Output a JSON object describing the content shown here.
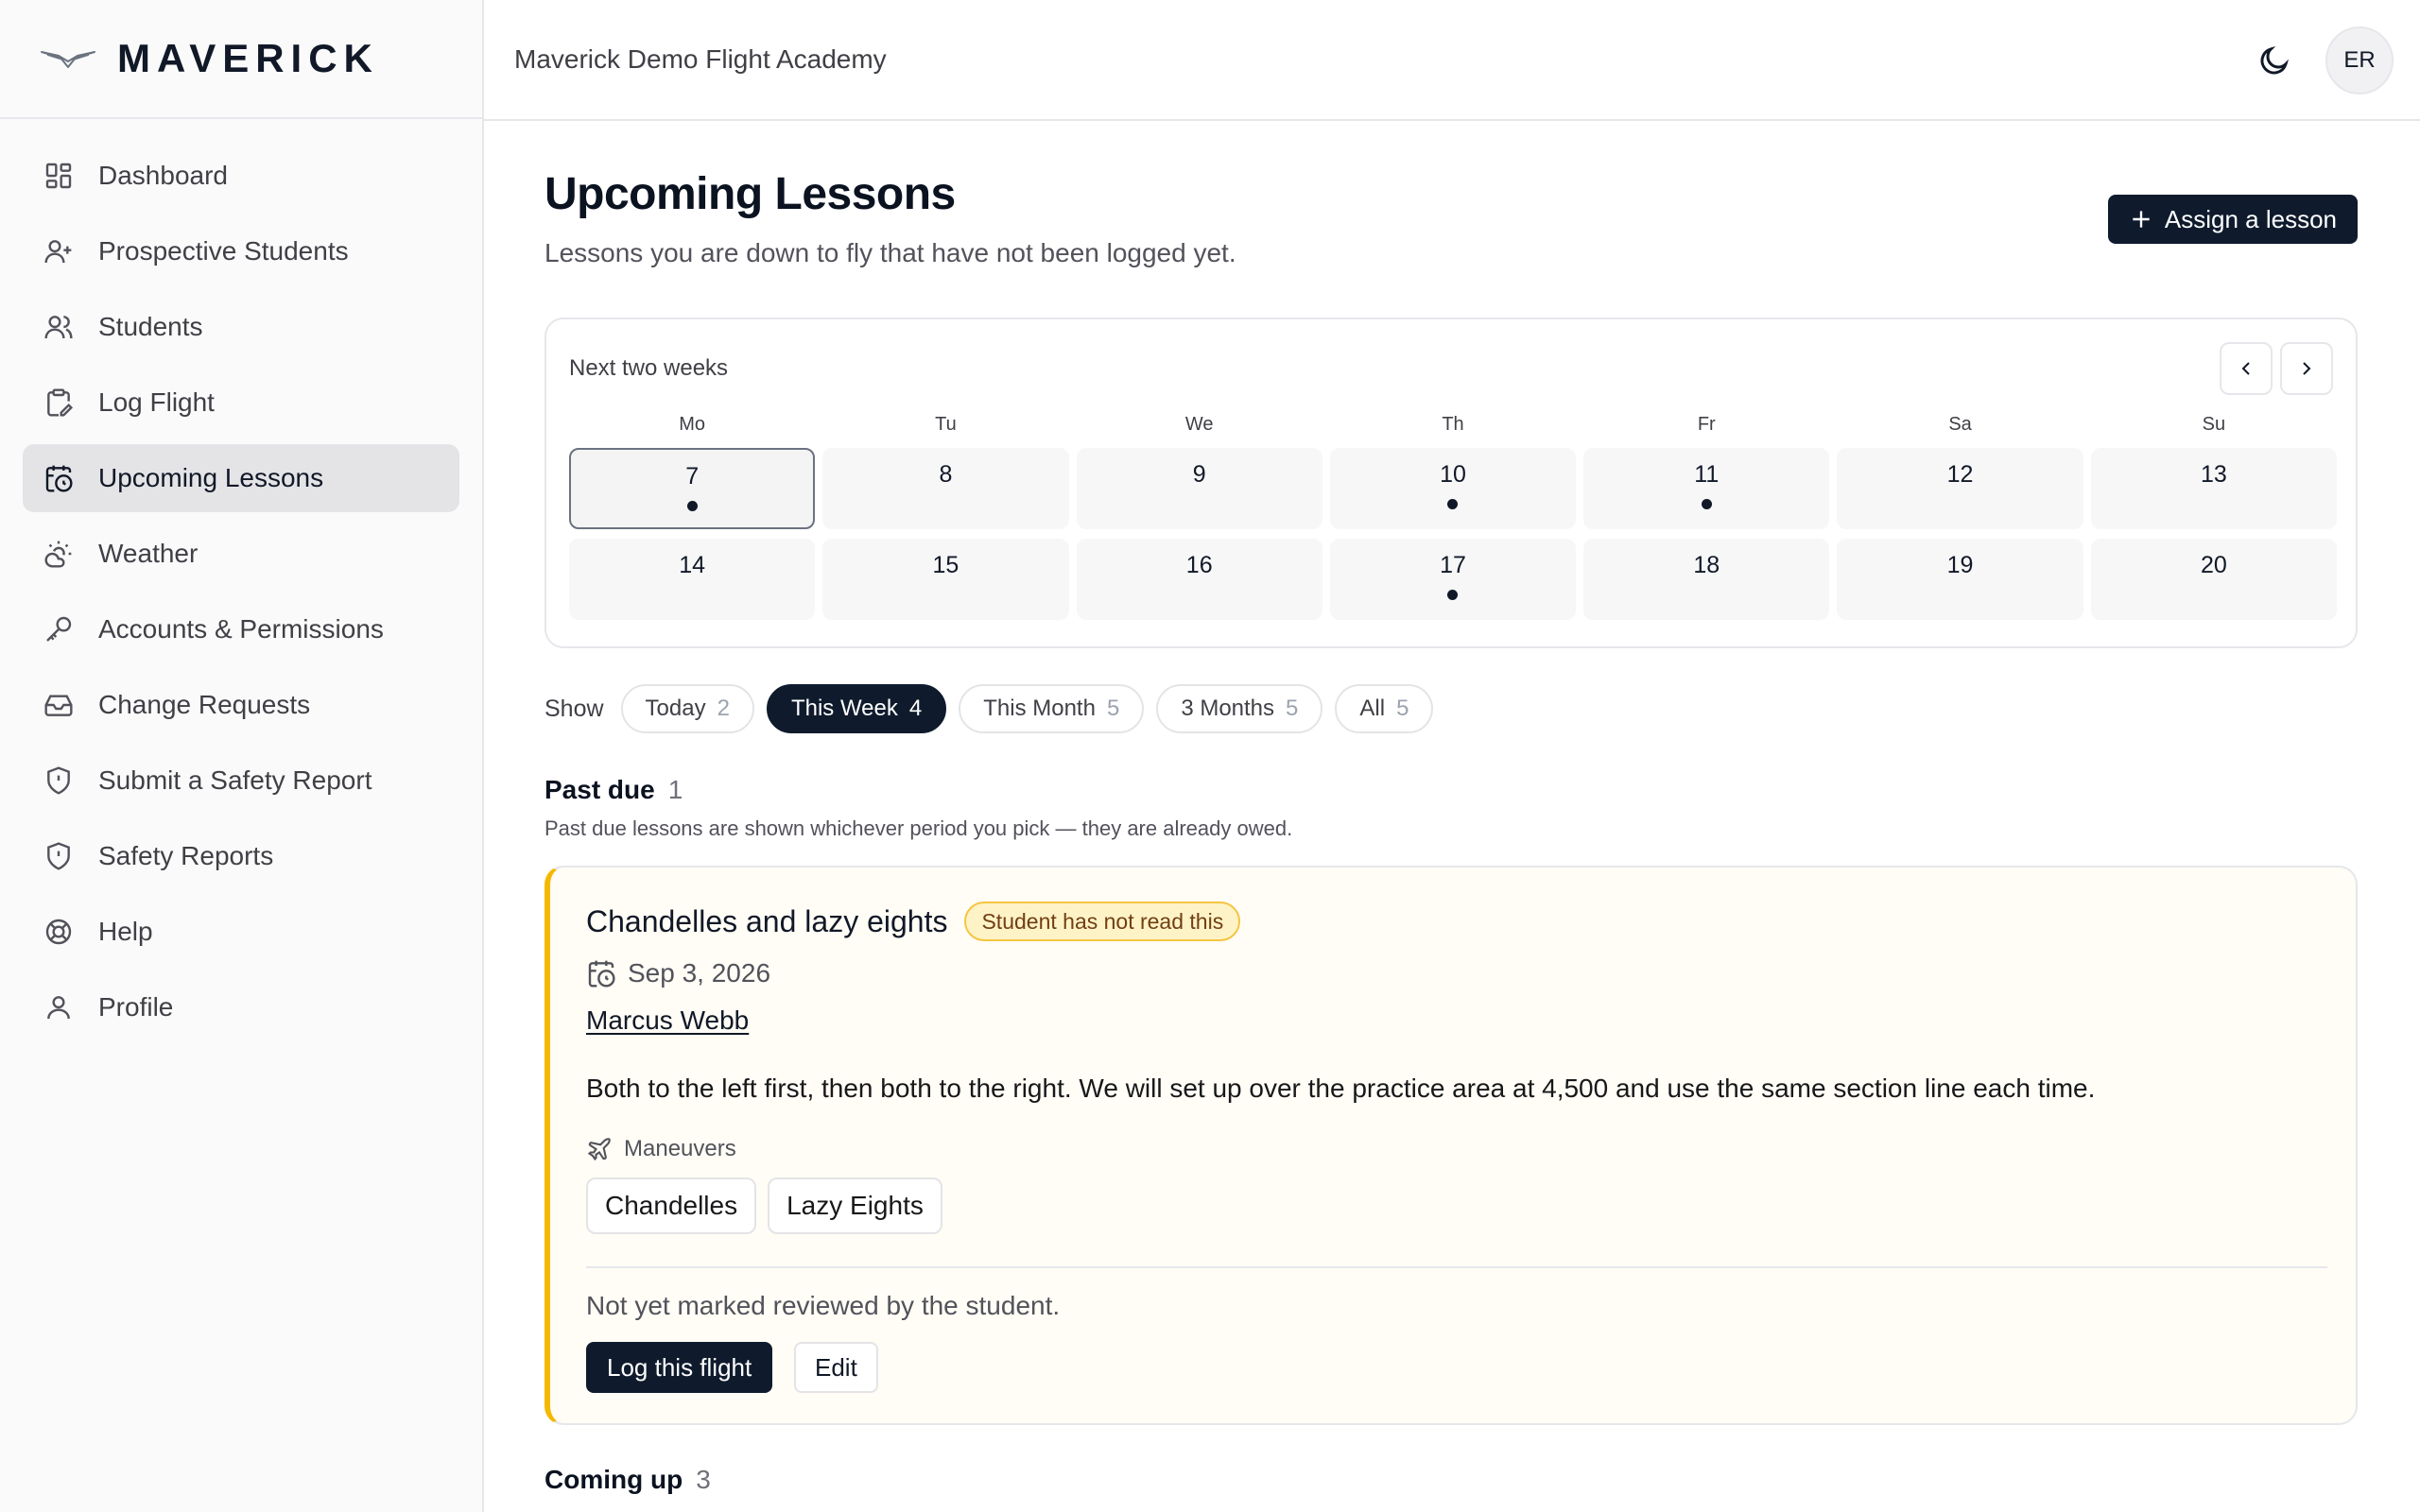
{
  "app": {
    "brand": "MAVERICK",
    "org_name": "Maverick Demo Flight Academy",
    "user_initials": "ER"
  },
  "sidebar": {
    "items": [
      {
        "label": "Dashboard",
        "icon": "dashboard-icon",
        "active": false
      },
      {
        "label": "Prospective Students",
        "icon": "user-plus-icon",
        "active": false
      },
      {
        "label": "Students",
        "icon": "users-icon",
        "active": false
      },
      {
        "label": "Log Flight",
        "icon": "clipboard-icon",
        "active": false
      },
      {
        "label": "Upcoming Lessons",
        "icon": "calendar-clock-icon",
        "active": true
      },
      {
        "label": "Weather",
        "icon": "weather-icon",
        "active": false
      },
      {
        "label": "Accounts & Permissions",
        "icon": "key-icon",
        "active": false
      },
      {
        "label": "Change Requests",
        "icon": "inbox-icon",
        "active": false
      },
      {
        "label": "Submit a Safety Report",
        "icon": "shield-alert-icon",
        "active": false
      },
      {
        "label": "Safety Reports",
        "icon": "shield-alert-icon",
        "active": false
      },
      {
        "label": "Help",
        "icon": "lifebuoy-icon",
        "active": false
      },
      {
        "label": "Profile",
        "icon": "user-icon",
        "active": false
      }
    ]
  },
  "page": {
    "title": "Upcoming Lessons",
    "subtitle": "Lessons you are down to fly that have not been logged yet.",
    "assign_label": "Assign a lesson"
  },
  "calendar": {
    "label": "Next two weeks",
    "weekdays": [
      "Mo",
      "Tu",
      "We",
      "Th",
      "Fr",
      "Sa",
      "Su"
    ],
    "weeks": [
      [
        {
          "day": "7",
          "has_lesson": true,
          "today": true
        },
        {
          "day": "8",
          "has_lesson": false,
          "today": false
        },
        {
          "day": "9",
          "has_lesson": false,
          "today": false
        },
        {
          "day": "10",
          "has_lesson": true,
          "today": false
        },
        {
          "day": "11",
          "has_lesson": true,
          "today": false
        },
        {
          "day": "12",
          "has_lesson": false,
          "today": false
        },
        {
          "day": "13",
          "has_lesson": false,
          "today": false
        }
      ],
      [
        {
          "day": "14",
          "has_lesson": false,
          "today": false
        },
        {
          "day": "15",
          "has_lesson": false,
          "today": false
        },
        {
          "day": "16",
          "has_lesson": false,
          "today": false
        },
        {
          "day": "17",
          "has_lesson": true,
          "today": false
        },
        {
          "day": "18",
          "has_lesson": false,
          "today": false
        },
        {
          "day": "19",
          "has_lesson": false,
          "today": false
        },
        {
          "day": "20",
          "has_lesson": false,
          "today": false
        }
      ]
    ]
  },
  "filters": {
    "label": "Show",
    "options": [
      {
        "label": "Today",
        "count": "2",
        "active": false
      },
      {
        "label": "This Week",
        "count": "4",
        "active": true
      },
      {
        "label": "This Month",
        "count": "5",
        "active": false
      },
      {
        "label": "3 Months",
        "count": "5",
        "active": false
      },
      {
        "label": "All",
        "count": "5",
        "active": false
      }
    ]
  },
  "past_due": {
    "title": "Past due",
    "count": "1",
    "note": "Past due lessons are shown whichever period you pick — they are already owed."
  },
  "lesson": {
    "title": "Chandelles and lazy eights",
    "badge": "Student has not read this",
    "date": "Sep 3, 2026",
    "student": "Marcus Webb",
    "description": "Both to the left first, then both to the right. We will set up over the practice area at 4,500 and use the same section line each time.",
    "maneuvers_label": "Maneuvers",
    "maneuvers": [
      "Chandelles",
      "Lazy Eights"
    ],
    "review_note": "Not yet marked reviewed by the student.",
    "log_label": "Log this flight",
    "edit_label": "Edit"
  },
  "coming_up": {
    "title": "Coming up",
    "count": "3"
  },
  "colors": {
    "accent_dark": "#0f1b2d",
    "past_due_stripe": "#f5b800",
    "badge_bg": "#fef3c7",
    "active_nav_bg": "#e4e4e7"
  }
}
